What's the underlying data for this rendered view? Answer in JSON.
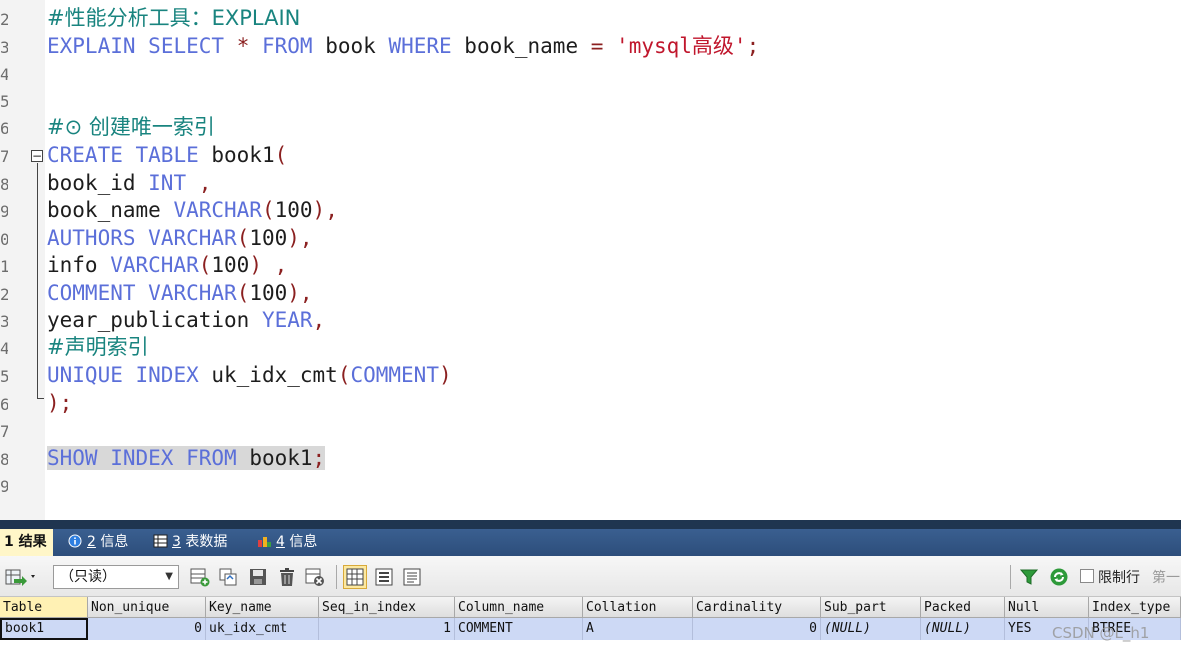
{
  "editor": {
    "gutter_numbers": [
      "2",
      "3",
      "4",
      "5",
      "6",
      "7",
      "8",
      "9",
      "0",
      "1",
      "2",
      "3",
      "4",
      "5",
      "6",
      "7",
      "8",
      "9"
    ],
    "lines": [
      {
        "id": "comment-explain",
        "tokens": [
          {
            "t": "#性能分析工具：EXPLAIN",
            "c": "cm"
          }
        ]
      },
      {
        "id": "explain-select",
        "tokens": [
          {
            "t": "EXPLAIN",
            "c": "kw"
          },
          {
            "t": " "
          },
          {
            "t": "SELECT",
            "c": "kw"
          },
          {
            "t": " "
          },
          {
            "t": "*",
            "c": "pn"
          },
          {
            "t": " "
          },
          {
            "t": "FROM",
            "c": "kw"
          },
          {
            "t": " book "
          },
          {
            "t": "WHERE",
            "c": "kw"
          },
          {
            "t": " book_name "
          },
          {
            "t": "=",
            "c": "pn"
          },
          {
            "t": " "
          },
          {
            "t": "'mysql高级'",
            "c": "str"
          },
          {
            "t": ";",
            "c": "pn"
          }
        ]
      },
      {
        "id": "blank-1",
        "tokens": []
      },
      {
        "id": "blank-2",
        "tokens": []
      },
      {
        "id": "comment-unique",
        "tokens": [
          {
            "t": "#⊙ 创建唯一索引",
            "c": "cm"
          }
        ]
      },
      {
        "id": "create-table",
        "tokens": [
          {
            "t": "CREATE",
            "c": "kw"
          },
          {
            "t": " "
          },
          {
            "t": "TABLE",
            "c": "kw"
          },
          {
            "t": " book1"
          },
          {
            "t": "(",
            "c": "pn"
          }
        ]
      },
      {
        "id": "col-book-id",
        "tokens": [
          {
            "t": "book_id "
          },
          {
            "t": "INT",
            "c": "kw"
          },
          {
            "t": " "
          },
          {
            "t": ",",
            "c": "pn"
          }
        ]
      },
      {
        "id": "col-book-name",
        "tokens": [
          {
            "t": "book_name "
          },
          {
            "t": "VARCHAR",
            "c": "kw"
          },
          {
            "t": "(",
            "c": "pn"
          },
          {
            "t": "100"
          },
          {
            "t": "),",
            "c": "pn"
          }
        ]
      },
      {
        "id": "col-authors",
        "tokens": [
          {
            "t": "AUTHORS",
            "c": "kw"
          },
          {
            "t": " "
          },
          {
            "t": "VARCHAR",
            "c": "kw"
          },
          {
            "t": "(",
            "c": "pn"
          },
          {
            "t": "100"
          },
          {
            "t": "),",
            "c": "pn"
          }
        ]
      },
      {
        "id": "col-info",
        "tokens": [
          {
            "t": "info "
          },
          {
            "t": "VARCHAR",
            "c": "kw"
          },
          {
            "t": "(",
            "c": "pn"
          },
          {
            "t": "100"
          },
          {
            "t": ")",
            "c": "pn"
          },
          {
            "t": " "
          },
          {
            "t": ",",
            "c": "pn"
          }
        ]
      },
      {
        "id": "col-comment",
        "tokens": [
          {
            "t": "COMMENT",
            "c": "kw"
          },
          {
            "t": " "
          },
          {
            "t": "VARCHAR",
            "c": "kw"
          },
          {
            "t": "(",
            "c": "pn"
          },
          {
            "t": "100"
          },
          {
            "t": "),",
            "c": "pn"
          }
        ]
      },
      {
        "id": "col-year",
        "tokens": [
          {
            "t": "year_publication "
          },
          {
            "t": "YEAR",
            "c": "kw"
          },
          {
            "t": ",",
            "c": "pn"
          }
        ]
      },
      {
        "id": "comment-declare",
        "tokens": [
          {
            "t": "#声明索引",
            "c": "cm"
          }
        ]
      },
      {
        "id": "unique-index",
        "tokens": [
          {
            "t": "UNIQUE",
            "c": "kw"
          },
          {
            "t": " "
          },
          {
            "t": "INDEX",
            "c": "kw"
          },
          {
            "t": " uk_idx_cmt"
          },
          {
            "t": "(",
            "c": "pn"
          },
          {
            "t": "COMMENT",
            "c": "kw"
          },
          {
            "t": ")",
            "c": "pn"
          }
        ]
      },
      {
        "id": "close-paren",
        "tokens": [
          {
            "t": ");",
            "c": "pn"
          }
        ]
      },
      {
        "id": "blank-3",
        "tokens": []
      },
      {
        "id": "show-index",
        "selected": true,
        "tokens": [
          {
            "t": "SHOW",
            "c": "kw"
          },
          {
            "t": " "
          },
          {
            "t": "INDEX",
            "c": "kw"
          },
          {
            "t": " "
          },
          {
            "t": "FROM",
            "c": "kw"
          },
          {
            "t": " book1"
          },
          {
            "t": ";",
            "c": "pn"
          }
        ]
      },
      {
        "id": "blank-4",
        "tokens": []
      }
    ]
  },
  "tabs": [
    {
      "num": "1",
      "label": "结果",
      "icon": "none",
      "active": true
    },
    {
      "num": "2",
      "label": "信息",
      "icon": "info-icon"
    },
    {
      "num": "3",
      "label": "表数据",
      "icon": "table-icon"
    },
    {
      "num": "4",
      "label": "信息",
      "icon": "profile-icon"
    }
  ],
  "toolbar": {
    "mode_value": "（只读）",
    "limit_label": "限制行",
    "first_label": "第一",
    "icons": [
      "export-icon",
      "add-row-icon",
      "duplicate-row-icon",
      "save-icon",
      "delete-icon",
      "cancel-icon",
      "grid-view-icon",
      "form-view-icon",
      "text-view-icon",
      "filter-icon",
      "refresh-icon"
    ]
  },
  "grid": {
    "columns": [
      "Table",
      "Non_unique",
      "Key_name",
      "Seq_in_index",
      "Column_name",
      "Collation",
      "Cardinality",
      "Sub_part",
      "Packed",
      "Null",
      "Index_type"
    ],
    "rows": [
      [
        "book1",
        "0",
        "uk_idx_cmt",
        "1",
        "COMMENT",
        "A",
        "0",
        "(NULL)",
        "(NULL)",
        "YES",
        "BTREE"
      ]
    ]
  },
  "watermark": "CSDN @L_h1",
  "colors": {
    "keyword": "#5b6fd9",
    "comment": "#19847f",
    "string": "#c0162c",
    "tabbar": "#2d4e7b",
    "active_tab": "#fff6c8",
    "row": "#cdd9f5"
  }
}
